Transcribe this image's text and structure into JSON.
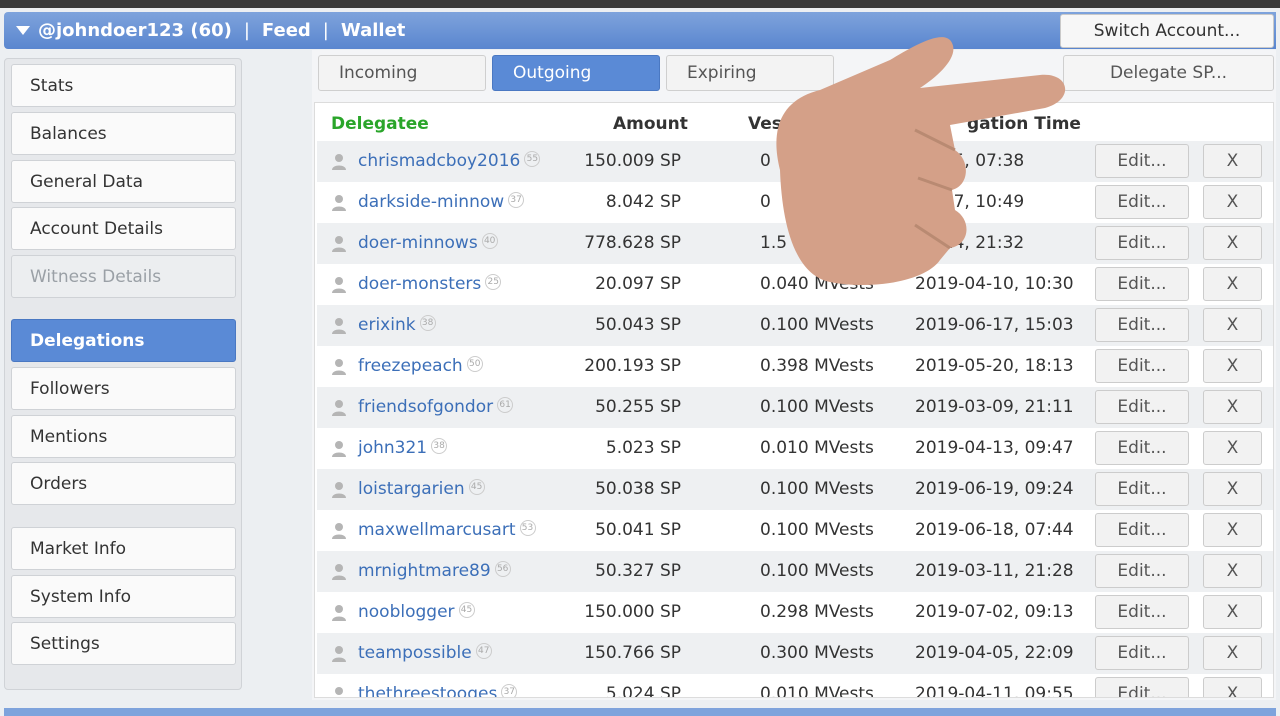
{
  "header": {
    "account": "@johndoer123 (60)",
    "sep1": "|",
    "feed": "Feed",
    "sep2": "|",
    "wallet": "Wallet",
    "switch_account": "Switch Account..."
  },
  "sidebar": {
    "items": [
      {
        "label": "Stats",
        "state": "normal"
      },
      {
        "label": "Balances",
        "state": "normal"
      },
      {
        "label": "General Data",
        "state": "normal"
      },
      {
        "label": "Account Details",
        "state": "normal"
      },
      {
        "label": "Witness Details",
        "state": "disabled"
      },
      {
        "label": "Delegations",
        "state": "active"
      },
      {
        "label": "Followers",
        "state": "normal"
      },
      {
        "label": "Mentions",
        "state": "normal"
      },
      {
        "label": "Orders",
        "state": "normal"
      },
      {
        "label": "Market Info",
        "state": "normal"
      },
      {
        "label": "System Info",
        "state": "normal"
      },
      {
        "label": "Settings",
        "state": "normal"
      }
    ]
  },
  "tabs": [
    {
      "label": "Incoming",
      "active": false
    },
    {
      "label": "Outgoing",
      "active": true
    },
    {
      "label": "Expiring",
      "active": false
    }
  ],
  "delegate_button": "Delegate SP...",
  "table": {
    "headers": {
      "delegatee": "Delegatee",
      "amount": "Amount",
      "vests": "Ves",
      "time": "gation Time"
    },
    "edit_label": "Edit...",
    "remove_label": "X",
    "rows": [
      {
        "name": "chrismadcboy2016",
        "rep": "55",
        "amount": "150.009 SP",
        "vests": "0",
        "time": "06-05, 07:38"
      },
      {
        "name": "darkside-minnow",
        "rep": "37",
        "amount": "8.042 SP",
        "vests": "0",
        "time": "03-17, 10:49"
      },
      {
        "name": "doer-minnows",
        "rep": "40",
        "amount": "778.628 SP",
        "vests": "1.5",
        "time": "03-14, 21:32"
      },
      {
        "name": "doer-monsters",
        "rep": "25",
        "amount": "20.097 SP",
        "vests": "0.040 MVests",
        "time": "2019-04-10, 10:30"
      },
      {
        "name": "erixink",
        "rep": "38",
        "amount": "50.043 SP",
        "vests": "0.100 MVests",
        "time": "2019-06-17, 15:03"
      },
      {
        "name": "freezepeach",
        "rep": "50",
        "amount": "200.193 SP",
        "vests": "0.398 MVests",
        "time": "2019-05-20, 18:13"
      },
      {
        "name": "friendsofgondor",
        "rep": "61",
        "amount": "50.255 SP",
        "vests": "0.100 MVests",
        "time": "2019-03-09, 21:11"
      },
      {
        "name": "john321",
        "rep": "38",
        "amount": "5.023 SP",
        "vests": "0.010 MVests",
        "time": "2019-04-13, 09:47"
      },
      {
        "name": "loistargarien",
        "rep": "45",
        "amount": "50.038 SP",
        "vests": "0.100 MVests",
        "time": "2019-06-19, 09:24"
      },
      {
        "name": "maxwellmarcusart",
        "rep": "53",
        "amount": "50.041 SP",
        "vests": "0.100 MVests",
        "time": "2019-06-18, 07:44"
      },
      {
        "name": "mrnightmare89",
        "rep": "56",
        "amount": "50.327 SP",
        "vests": "0.100 MVests",
        "time": "2019-03-11, 21:28"
      },
      {
        "name": "nooblogger",
        "rep": "45",
        "amount": "150.000 SP",
        "vests": "0.298 MVests",
        "time": "2019-07-02, 09:13"
      },
      {
        "name": "teampossible",
        "rep": "47",
        "amount": "150.766 SP",
        "vests": "0.300 MVests",
        "time": "2019-04-05, 22:09"
      },
      {
        "name": "thethreestooges",
        "rep": "37",
        "amount": "5.024 SP",
        "vests": "0.010 MVests",
        "time": "2019-04-11, 09:55"
      }
    ]
  },
  "colors": {
    "accent": "#5a8ad6",
    "link": "#3c6fb8",
    "delegatee_header": "#2aa52a"
  }
}
